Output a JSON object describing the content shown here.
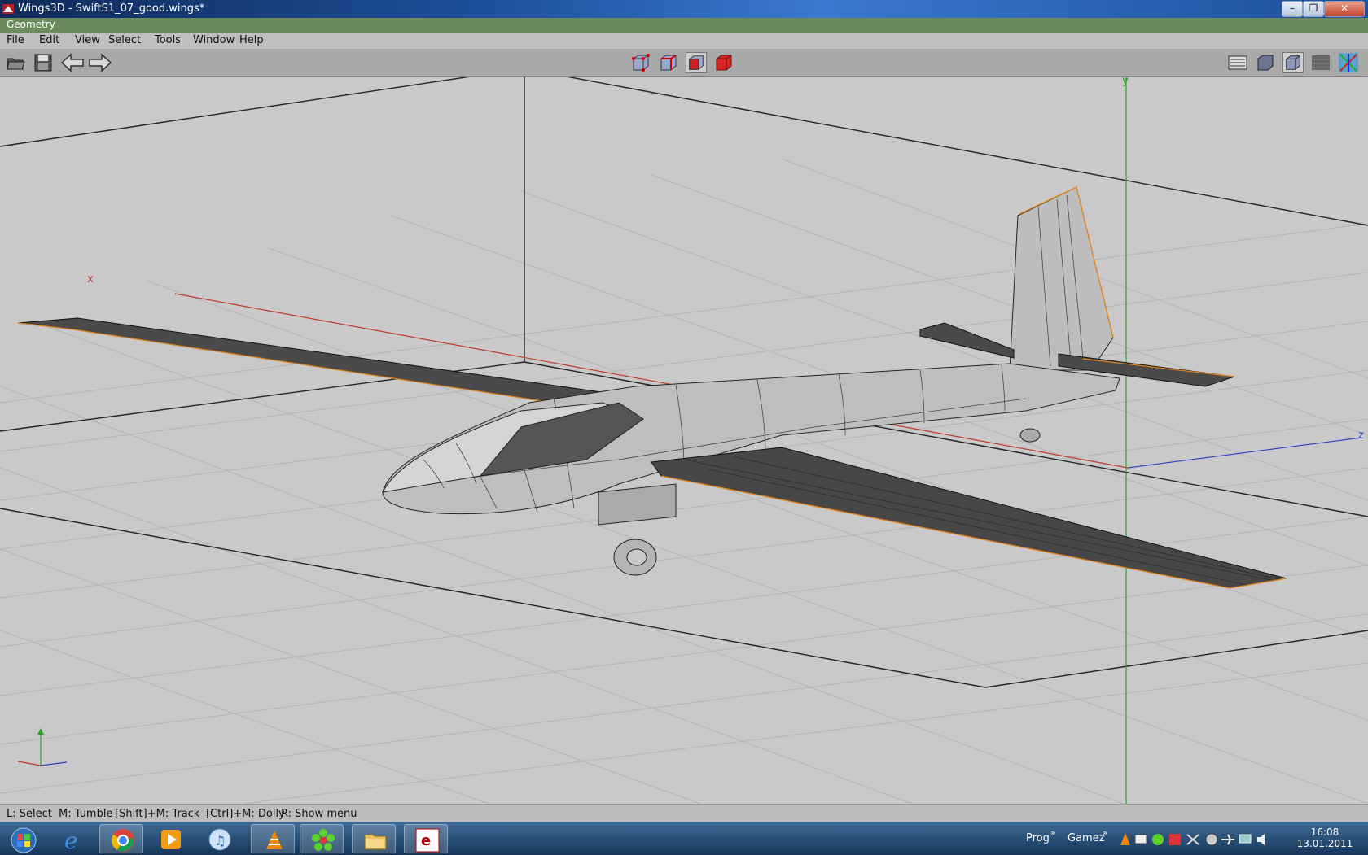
{
  "window": {
    "title": "Wings3D - SwiftS1_07_good.wings*",
    "buttons": {
      "minimize": "–",
      "maximize": "❐",
      "close": "✕"
    }
  },
  "geometry_bar": {
    "label": "Geometry"
  },
  "menu": {
    "items": [
      {
        "label": "File"
      },
      {
        "label": "Edit"
      },
      {
        "label": "View"
      },
      {
        "label": "Select"
      },
      {
        "label": "Tools"
      },
      {
        "label": "Window"
      },
      {
        "label": "Help"
      }
    ]
  },
  "toolbar": {
    "left_icons": [
      "open-file-icon",
      "save-icon",
      "undo-arrow-icon",
      "redo-arrow-icon"
    ],
    "mode_icons": [
      "vertex-mode-icon",
      "edge-mode-icon",
      "face-mode-icon",
      "body-mode-icon"
    ],
    "active_mode": "face-mode-icon",
    "right_icons": [
      "groundplane-toggle-icon",
      "smooth-shading-icon",
      "flat-shading-icon",
      "wireframe-icon",
      "axes-toggle-icon"
    ]
  },
  "viewport": {
    "axis_labels": {
      "x": "x",
      "y": "y",
      "z": "z"
    },
    "colors": {
      "x_axis": "#c0392b",
      "y_axis": "#27a327",
      "z_axis": "#2a3fbf",
      "selection": "#e8851b"
    }
  },
  "status": {
    "items": [
      {
        "label": "L: Select"
      },
      {
        "label": "M: Tumble"
      },
      {
        "label": "[Shift]+M: Track"
      },
      {
        "label": "[Ctrl]+M: Dolly"
      },
      {
        "label": "R: Show menu"
      }
    ]
  },
  "taskbar": {
    "apps": [
      "start-orb-icon",
      "internet-explorer-icon",
      "chrome-icon",
      "media-player-icon",
      "itunes-icon",
      "vlc-icon",
      "icq-icon",
      "file-explorer-icon",
      "erlang-icon"
    ],
    "toolbars": [
      {
        "label": "Prog"
      },
      {
        "label": "Gamez"
      }
    ],
    "chevron": "»",
    "clock": {
      "time": "16:08",
      "date": "13.01.2011"
    }
  }
}
